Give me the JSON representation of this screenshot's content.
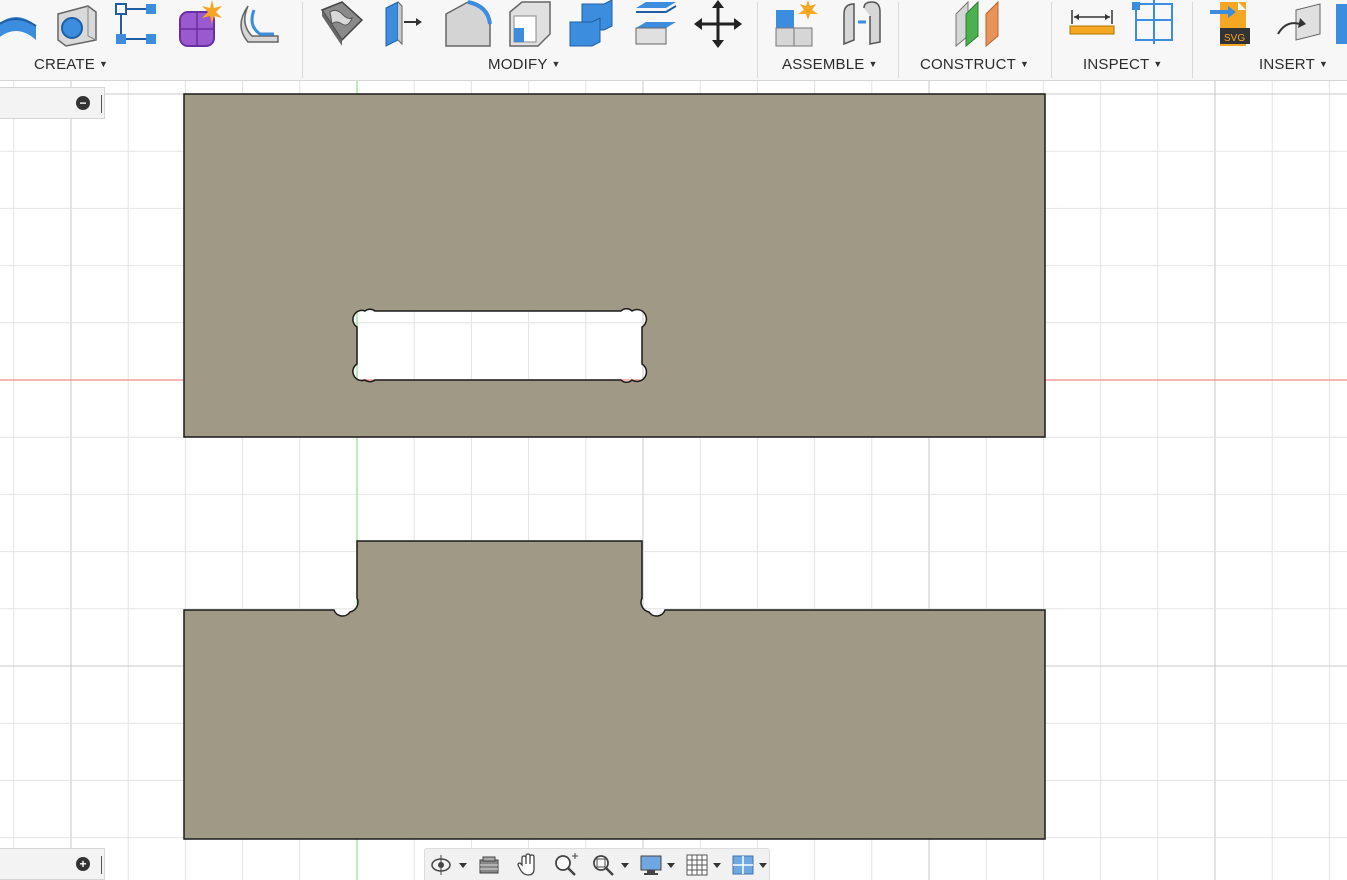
{
  "toolbar": {
    "groups": {
      "create": "CREATE",
      "modify": "MODIFY",
      "assemble": "ASSEMBLE",
      "construct": "CONSTRUCT",
      "inspect": "INSPECT",
      "insert": "INSERT"
    },
    "icons": {
      "create": [
        "revolve-icon",
        "hole-icon",
        "rectangular-pattern-icon",
        "form-icon",
        "web-icon"
      ],
      "modify": [
        "press-pull-icon",
        "offset-face-icon",
        "fillet-icon",
        "shell-icon",
        "combine-icon",
        "replace-face-icon",
        "move-icon"
      ],
      "assemble": [
        "new-component-icon",
        "joint-icon"
      ],
      "construct": [
        "offset-plane-icon"
      ],
      "inspect": [
        "measure-icon",
        "section-analysis-icon"
      ],
      "insert": [
        "insert-svg-icon",
        "insert-derive-icon"
      ]
    },
    "colors": {
      "accent_blue": "#3c8dde",
      "accent_orange": "#f5a623"
    }
  },
  "canvas": {
    "colors": {
      "body_fill": "#a09985",
      "grid_minor": "#e4e4e4",
      "grid_major": "#c9c9c9",
      "axis_x": "#f08a8a",
      "axis_y": "#8fe08f"
    },
    "bodies": [
      "panel-with-slot",
      "panel-with-tab"
    ]
  },
  "browser_panel": {
    "collapse_symbol": "−"
  },
  "comments_panel": {
    "expand_symbol": "+"
  },
  "navbar": {
    "icons": [
      "orbit-icon",
      "look-at-icon",
      "pan-icon",
      "zoom-icon",
      "fit-icon",
      "display-settings-icon",
      "grid-settings-icon",
      "viewports-icon"
    ]
  }
}
